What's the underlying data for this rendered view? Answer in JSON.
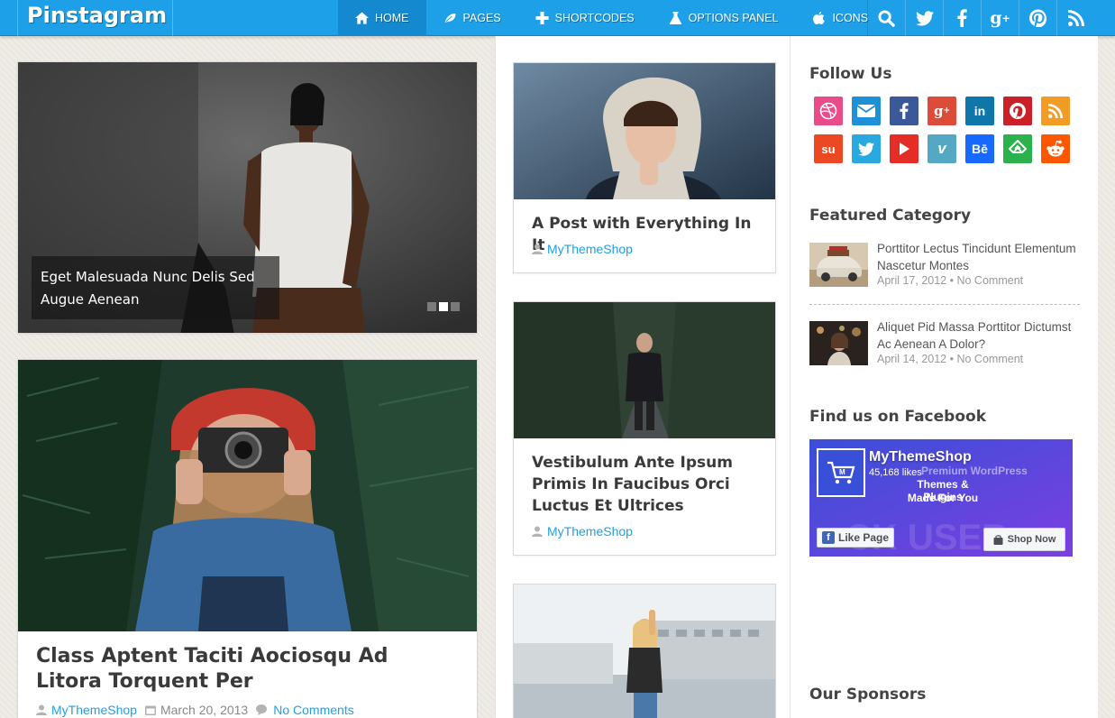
{
  "nav": {
    "logo": "Pinstagram",
    "menu": [
      {
        "label": "HOME",
        "icon": "home-icon",
        "active": true
      },
      {
        "label": "PAGES",
        "icon": "leaf-icon",
        "active": false
      },
      {
        "label": "SHORTCODES",
        "icon": "plus-icon",
        "active": false
      },
      {
        "label": "OPTIONS PANEL",
        "icon": "flask-icon",
        "active": false
      },
      {
        "label": "ICONS",
        "icon": "apple-icon",
        "active": false
      }
    ],
    "social": [
      "search-icon",
      "twitter-icon",
      "facebook-icon",
      "google-plus-icon",
      "pinterest-icon",
      "rss-icon"
    ]
  },
  "slider": {
    "caption": "Eget Malesuada Nunc Delis Sed Augue Aenean",
    "slides": 3,
    "active_slide": 2
  },
  "posts": {
    "left_big": {
      "title": "Class Aptent Taciti Aociosqu Ad Litora Torquent Per",
      "author": "MyThemeShop",
      "date": "March 20, 2013",
      "comments": "No Comments"
    },
    "mid1": {
      "title": "A Post with Everything In It",
      "author": "MyThemeShop"
    },
    "mid2": {
      "title": "Vestibulum Ante Ipsum Primis In Faucibus Orci Luctus Et Ultrices",
      "author": "MyThemeShop"
    }
  },
  "sidebar": {
    "follow_title": "Follow Us",
    "follow_icons": [
      {
        "name": "dribbble-icon",
        "color": "#ea4c89"
      },
      {
        "name": "email-icon",
        "color": "#1e90d8"
      },
      {
        "name": "facebook-icon",
        "color": "#3b5998"
      },
      {
        "name": "google-plus-icon",
        "color": "#dd4b39"
      },
      {
        "name": "linkedin-icon",
        "color": "#0e76a8"
      },
      {
        "name": "pinterest-icon",
        "color": "#cb2027"
      },
      {
        "name": "rss-icon",
        "color": "#f39c25"
      },
      {
        "name": "stumbleupon-icon",
        "color": "#eb4924"
      },
      {
        "name": "twitter-icon",
        "color": "#2aa9e0"
      },
      {
        "name": "youtube-icon",
        "color": "#e52d27"
      },
      {
        "name": "vimeo-icon",
        "color": "#55a8c4"
      },
      {
        "name": "behance-icon",
        "color": "#1769ff"
      },
      {
        "name": "feedly-icon",
        "color": "#2bb24c"
      },
      {
        "name": "reddit-icon",
        "color": "#ff5700"
      }
    ],
    "featured_title": "Featured Category",
    "featured": [
      {
        "title": "Porttitor Lectus Tincidunt Elementum Nascetur Montes",
        "date": "April 17, 2012",
        "comments": "No Comment"
      },
      {
        "title": "Aliquet Pid Massa Porttitor Dictumst Ac Aenean A Dolor?",
        "date": "April 14, 2012",
        "comments": "No Comment"
      }
    ],
    "facebook_title": "Find us on Facebook",
    "facebook": {
      "page_name": "MyThemeShop",
      "likes": "45,168 likes",
      "tagline_1": "Premium WordPress",
      "tagline_2": "Themes & Plugins",
      "tagline_3": "Made For You",
      "like_button": "Like Page",
      "shop_button": "Shop Now"
    },
    "sponsors_title": "Our Sponsors"
  },
  "colors": {
    "accent": "#1ea0e8",
    "accent_dark": "#1589cf"
  }
}
